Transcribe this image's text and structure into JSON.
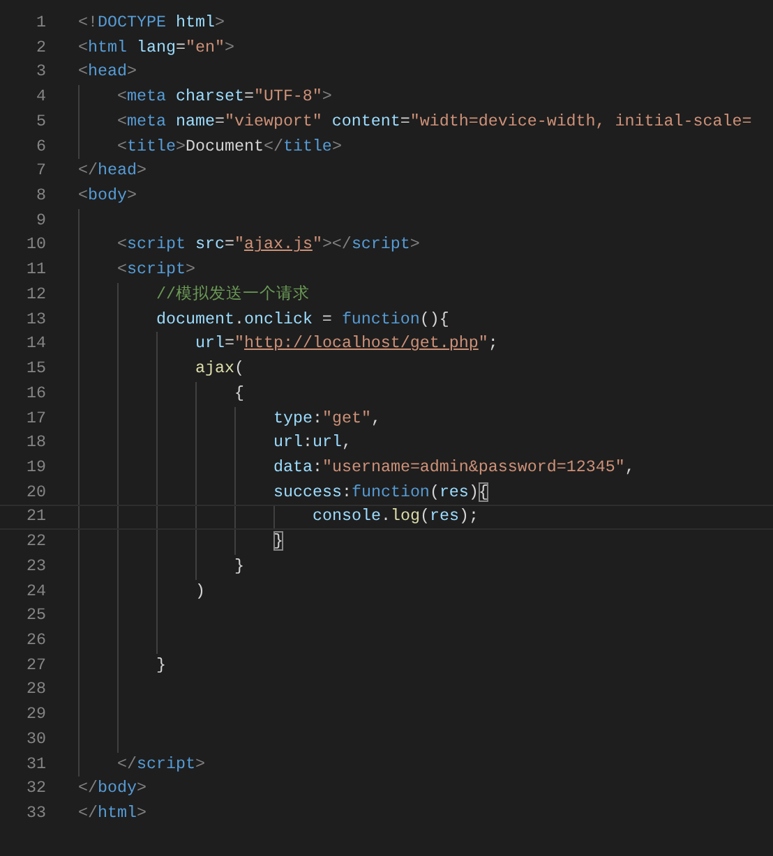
{
  "editor": {
    "lines": [
      {
        "number": "1",
        "current": false,
        "tokens": [
          {
            "kind": "punct",
            "text": "<!"
          },
          {
            "kind": "tag",
            "text": "DOCTYPE"
          },
          {
            "kind": "attr",
            "text": " html"
          },
          {
            "kind": "punct",
            "text": ">"
          }
        ]
      },
      {
        "number": "2",
        "current": false,
        "tokens": [
          {
            "kind": "punct",
            "text": "<"
          },
          {
            "kind": "tag",
            "text": "html"
          },
          {
            "kind": "attr",
            "text": " lang"
          },
          {
            "kind": "text",
            "text": "="
          },
          {
            "kind": "string",
            "text": "\"en\""
          },
          {
            "kind": "punct",
            "text": ">"
          }
        ]
      },
      {
        "number": "3",
        "current": false,
        "tokens": [
          {
            "kind": "punct",
            "text": "<"
          },
          {
            "kind": "tag",
            "text": "head"
          },
          {
            "kind": "punct",
            "text": ">"
          }
        ],
        "children": [
          {
            "number": "4",
            "current": false,
            "tokens": [
              {
                "kind": "punct",
                "text": "<"
              },
              {
                "kind": "tag",
                "text": "meta"
              },
              {
                "kind": "attr",
                "text": " charset"
              },
              {
                "kind": "text",
                "text": "="
              },
              {
                "kind": "string",
                "text": "\"UTF-8\""
              },
              {
                "kind": "punct",
                "text": ">"
              }
            ]
          },
          {
            "number": "5",
            "current": false,
            "tokens": [
              {
                "kind": "punct",
                "text": "<"
              },
              {
                "kind": "tag",
                "text": "meta"
              },
              {
                "kind": "attr",
                "text": " name"
              },
              {
                "kind": "text",
                "text": "="
              },
              {
                "kind": "string",
                "text": "\"viewport\""
              },
              {
                "kind": "attr",
                "text": " content"
              },
              {
                "kind": "text",
                "text": "="
              },
              {
                "kind": "string",
                "text": "\"width=device-width, initial-scale="
              }
            ]
          },
          {
            "number": "6",
            "current": false,
            "tokens": [
              {
                "kind": "punct",
                "text": "<"
              },
              {
                "kind": "tag",
                "text": "title"
              },
              {
                "kind": "punct",
                "text": ">"
              },
              {
                "kind": "text",
                "text": "Document"
              },
              {
                "kind": "punct",
                "text": "</"
              },
              {
                "kind": "tag",
                "text": "title"
              },
              {
                "kind": "punct",
                "text": ">"
              }
            ]
          }
        ]
      },
      {
        "number": "7",
        "current": false,
        "tokens": [
          {
            "kind": "punct",
            "text": "</"
          },
          {
            "kind": "tag",
            "text": "head"
          },
          {
            "kind": "punct",
            "text": ">"
          }
        ]
      },
      {
        "number": "8",
        "current": false,
        "tokens": [
          {
            "kind": "punct",
            "text": "<"
          },
          {
            "kind": "tag",
            "text": "body"
          },
          {
            "kind": "punct",
            "text": ">"
          }
        ],
        "children": [
          {
            "number": "9",
            "current": false
          },
          {
            "number": "10",
            "current": false,
            "tokens": [
              {
                "kind": "punct",
                "text": "<"
              },
              {
                "kind": "tag",
                "text": "script"
              },
              {
                "kind": "attr",
                "text": " src"
              },
              {
                "kind": "text",
                "text": "="
              },
              {
                "kind": "string",
                "text": "\""
              },
              {
                "kind": "link",
                "text": "ajax.js"
              },
              {
                "kind": "string",
                "text": "\""
              },
              {
                "kind": "punct",
                "text": "></"
              },
              {
                "kind": "tag",
                "text": "script"
              },
              {
                "kind": "punct",
                "text": ">"
              }
            ]
          },
          {
            "number": "11",
            "current": false,
            "tokens": [
              {
                "kind": "punct",
                "text": "<"
              },
              {
                "kind": "tag",
                "text": "script"
              },
              {
                "kind": "punct",
                "text": ">"
              }
            ],
            "children": [
              {
                "number": "12",
                "current": false,
                "tokens": [
                  {
                    "kind": "comment",
                    "text": "//模拟发送一个请求"
                  }
                ]
              },
              {
                "number": "13",
                "current": false,
                "tokens": [
                  {
                    "kind": "var",
                    "text": "document"
                  },
                  {
                    "kind": "text",
                    "text": "."
                  },
                  {
                    "kind": "var",
                    "text": "onclick"
                  },
                  {
                    "kind": "text",
                    "text": " = "
                  },
                  {
                    "kind": "keyword",
                    "text": "function"
                  },
                  {
                    "kind": "text",
                    "text": "(){"
                  }
                ],
                "children": [
                  {
                    "number": "14",
                    "current": false,
                    "tokens": [
                      {
                        "kind": "var",
                        "text": "url"
                      },
                      {
                        "kind": "text",
                        "text": "="
                      },
                      {
                        "kind": "string",
                        "text": "\""
                      },
                      {
                        "kind": "link",
                        "text": "http://localhost/get.php"
                      },
                      {
                        "kind": "string",
                        "text": "\""
                      },
                      {
                        "kind": "text",
                        "text": ";"
                      }
                    ]
                  },
                  {
                    "number": "15",
                    "current": false,
                    "tokens": [
                      {
                        "kind": "func",
                        "text": "ajax"
                      },
                      {
                        "kind": "text",
                        "text": "("
                      }
                    ],
                    "children": [
                      {
                        "number": "16",
                        "current": false,
                        "tokens": [
                          {
                            "kind": "text",
                            "text": "{"
                          }
                        ],
                        "children": [
                          {
                            "number": "17",
                            "current": false,
                            "tokens": [
                              {
                                "kind": "var",
                                "text": "type"
                              },
                              {
                                "kind": "text",
                                "text": ":"
                              },
                              {
                                "kind": "string",
                                "text": "\"get\""
                              },
                              {
                                "kind": "text",
                                "text": ","
                              }
                            ]
                          },
                          {
                            "number": "18",
                            "current": false,
                            "tokens": [
                              {
                                "kind": "var",
                                "text": "url"
                              },
                              {
                                "kind": "text",
                                "text": ":"
                              },
                              {
                                "kind": "var",
                                "text": "url"
                              },
                              {
                                "kind": "text",
                                "text": ","
                              }
                            ]
                          },
                          {
                            "number": "19",
                            "current": false,
                            "tokens": [
                              {
                                "kind": "var",
                                "text": "data"
                              },
                              {
                                "kind": "text",
                                "text": ":"
                              },
                              {
                                "kind": "string",
                                "text": "\"username=admin&password=12345\""
                              },
                              {
                                "kind": "text",
                                "text": ","
                              }
                            ]
                          },
                          {
                            "number": "20",
                            "current": false,
                            "tokens": [
                              {
                                "kind": "var",
                                "text": "success"
                              },
                              {
                                "kind": "text",
                                "text": ":"
                              },
                              {
                                "kind": "keyword",
                                "text": "function"
                              },
                              {
                                "kind": "text",
                                "text": "("
                              },
                              {
                                "kind": "var",
                                "text": "res"
                              },
                              {
                                "kind": "text",
                                "text": ")"
                              },
                              {
                                "kind": "bracket",
                                "text": "{"
                              }
                            ],
                            "children": [
                              {
                                "number": "21",
                                "current": true,
                                "tokens": [
                                  {
                                    "kind": "var",
                                    "text": "console"
                                  },
                                  {
                                    "kind": "text",
                                    "text": "."
                                  },
                                  {
                                    "kind": "func",
                                    "text": "log"
                                  },
                                  {
                                    "kind": "text",
                                    "text": "("
                                  },
                                  {
                                    "kind": "var",
                                    "text": "res"
                                  },
                                  {
                                    "kind": "text",
                                    "text": ");"
                                  }
                                ]
                              }
                            ]
                          },
                          {
                            "number": "22",
                            "current": false,
                            "tokens": [
                              {
                                "kind": "bracket",
                                "text": "}"
                              }
                            ]
                          }
                        ]
                      },
                      {
                        "number": "23",
                        "current": false,
                        "tokens": [
                          {
                            "kind": "text",
                            "text": "}"
                          }
                        ]
                      }
                    ]
                  },
                  {
                    "number": "24",
                    "current": false,
                    "tokens": [
                      {
                        "kind": "text",
                        "text": ")"
                      }
                    ]
                  },
                  {
                    "number": "25",
                    "current": false
                  },
                  {
                    "number": "26",
                    "current": false
                  }
                ]
              },
              {
                "number": "27",
                "current": false,
                "tokens": [
                  {
                    "kind": "text",
                    "text": "}"
                  }
                ]
              },
              {
                "number": "28",
                "current": false
              },
              {
                "number": "29",
                "current": false
              },
              {
                "number": "30",
                "current": false
              }
            ]
          },
          {
            "number": "31",
            "current": false,
            "tokens": [
              {
                "kind": "punct",
                "text": "</"
              },
              {
                "kind": "tag",
                "text": "script"
              },
              {
                "kind": "punct",
                "text": ">"
              }
            ]
          }
        ]
      },
      {
        "number": "32",
        "current": false,
        "tokens": [
          {
            "kind": "punct",
            "text": "</"
          },
          {
            "kind": "tag",
            "text": "body"
          },
          {
            "kind": "punct",
            "text": ">"
          }
        ]
      },
      {
        "number": "33",
        "current": false,
        "tokens": [
          {
            "kind": "punct",
            "text": "</"
          },
          {
            "kind": "tag",
            "text": "html"
          },
          {
            "kind": "punct",
            "text": ">"
          }
        ]
      }
    ]
  }
}
